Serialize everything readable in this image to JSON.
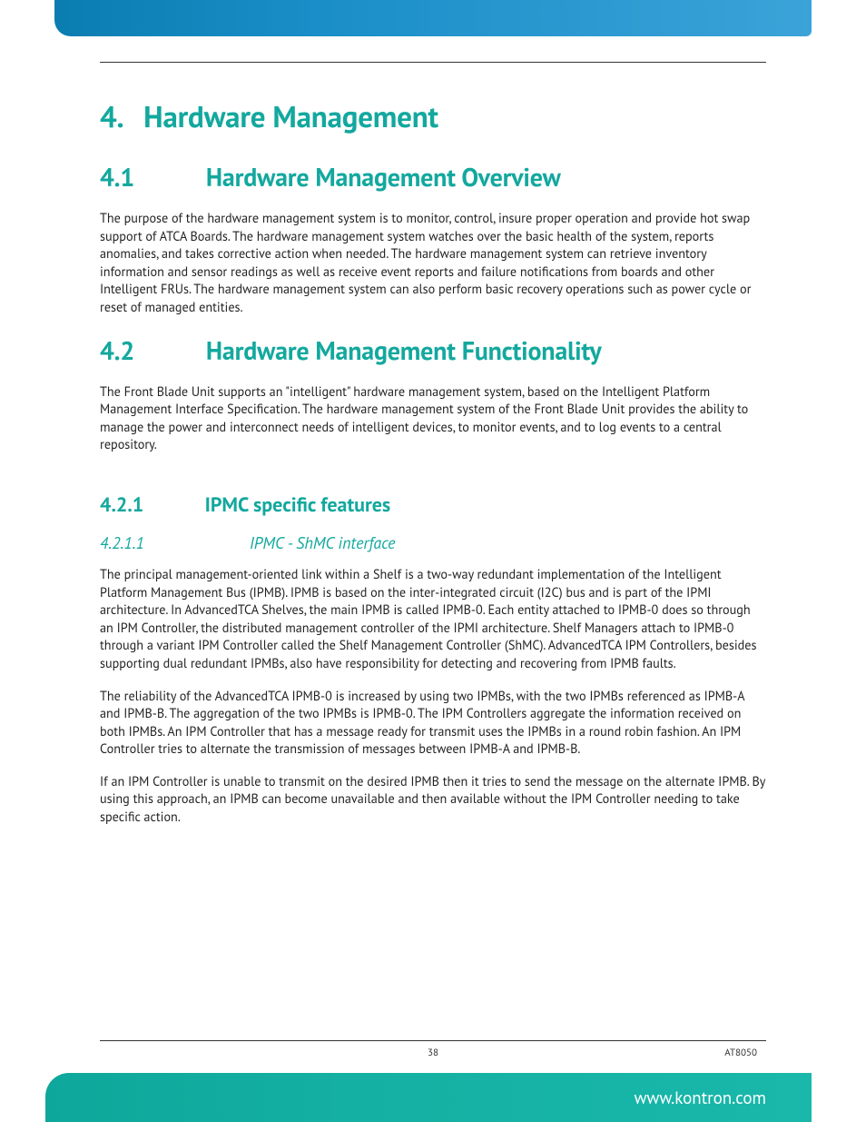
{
  "headings": {
    "s4": {
      "num": "4.",
      "title": "Hardware Management"
    },
    "s41": {
      "num": "4.1",
      "title": "Hardware Management Overview"
    },
    "s42": {
      "num": "4.2",
      "title": "Hardware Management Functionality"
    },
    "s421": {
      "num": "4.2.1",
      "title": "IPMC specific features"
    },
    "s4211": {
      "num": "4.2.1.1",
      "title": "IPMC - ShMC interface"
    }
  },
  "paragraphs": {
    "p41": "The purpose of the hardware management system is to monitor, control, insure proper operation and provide hot swap support of ATCA Boards. The hardware management system watches over the basic health of the system, reports anomalies, and takes corrective action when needed. The hardware management system can retrieve inventory information and sensor readings as well as receive event reports and failure notifications from boards and other Intelligent FRUs. The hardware management system can also perform basic recovery operations such as power cycle or reset of managed entities.",
    "p42": "The Front Blade Unit supports an \"intelligent\" hardware management system, based on the Intelligent Platform Management Interface Specification. The hardware management system of the Front Blade Unit provides the ability to manage the power and interconnect needs of intelligent devices, to monitor events, and to log events to a central repository.",
    "p4211a": "The principal management-oriented link within a Shelf is a two-way redundant implementation of the Intelligent Platform Management Bus (IPMB). IPMB is based on the inter-integrated circuit (I2C) bus and is part of the IPMI architecture. In AdvancedTCA Shelves, the main IPMB is called IPMB-0. Each entity attached to IPMB-0 does so through an IPM Controller, the distributed management controller of the IPMI architecture. Shelf Managers attach to IPMB-0 through a variant IPM Controller called the Shelf Management Controller (ShMC). AdvancedTCA IPM Controllers, besides supporting dual redundant IPMBs, also have responsibility for detecting and recovering from IPMB faults.",
    "p4211b": "The reliability of the AdvancedTCA IPMB-0 is increased by using two IPMBs, with the two IPMBs referenced as IPMB-A and IPMB-B. The aggregation of the two IPMBs is IPMB-0. The IPM Controllers aggregate the information received on both IPMBs. An IPM Controller that has a message ready for transmit uses the IPMBs in a round robin fashion. An IPM Controller tries to alternate the transmission of messages between IPMB-A and IPMB-B.",
    "p4211c": "If an IPM Controller is unable to transmit on the desired IPMB then it tries to send the message on the alternate IPMB. By using this approach, an IPMB can become unavailable and then available without the IPM Controller needing to take specific action."
  },
  "footer": {
    "page": "38",
    "doc": "AT8050",
    "website": "www.kontron.com"
  }
}
